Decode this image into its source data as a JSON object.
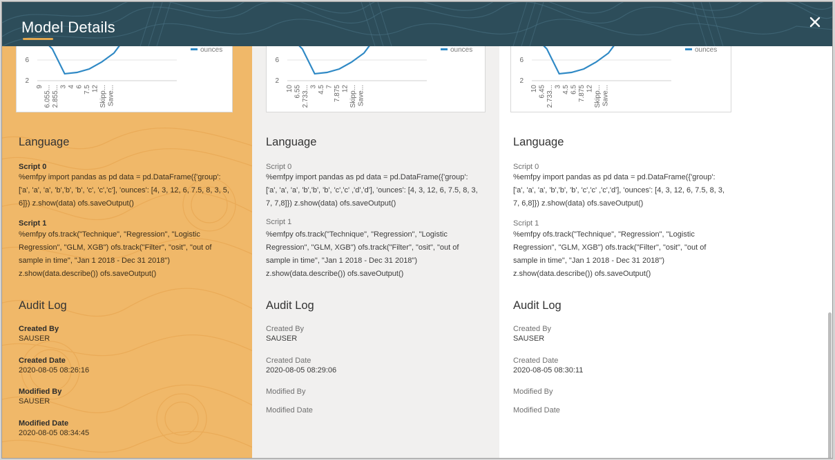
{
  "header": {
    "title": "Model Details",
    "close_icon": "close-icon"
  },
  "colors": {
    "header_bg": "#2d4d5a",
    "accent": "#e3a84f",
    "selected_column_bg": "#f0b869",
    "line": "#2f89c5"
  },
  "columns": [
    {
      "chart": {
        "legend": "ounces",
        "y_ticks": [
          "6",
          "2"
        ],
        "x_ticks": [
          "9",
          "6.055...",
          "2.855...",
          "3",
          "4",
          "6",
          "7.5",
          "12",
          "Skipp...",
          "Save..."
        ]
      },
      "language": {
        "title": "Language",
        "script0_label": "Script 0",
        "script0_lines": [
          "%emfpy import pandas as pd data = pd.DataFrame({'group':",
          "['a', 'a', 'a', 'b','b', 'b', 'c', 'c','c'], 'ounces': [4, 3, 12, 6, 7.5, 8, 3, 5,",
          "6]}) z.show(data) ofs.saveOutput()"
        ],
        "script1_label": "Script 1",
        "script1_lines": [
          "%emfpy ofs.track(\"Technique\", \"Regression\", \"Logistic",
          "Regression\", \"GLM, XGB\") ofs.track(\"Filter\", \"osit\", \"out of",
          "sample in time\", \"Jan 1 2018 - Dec 31 2018\")",
          "z.show(data.describe()) ofs.saveOutput()"
        ]
      },
      "audit": {
        "title": "Audit Log",
        "created_by_label": "Created By",
        "created_by": "SAUSER",
        "created_date_label": "Created Date",
        "created_date": "2020-08-05 08:26:16",
        "modified_by_label": "Modified By",
        "modified_by": "SAUSER",
        "modified_date_label": "Modified Date",
        "modified_date": "2020-08-05 08:34:45"
      }
    },
    {
      "chart": {
        "legend": "ounces",
        "y_ticks": [
          "6",
          "2"
        ],
        "x_ticks": [
          "10",
          "6.55",
          "2.733...",
          "3",
          "4.5",
          "7",
          "7.875",
          "12",
          "Skipp...",
          "Save..."
        ]
      },
      "language": {
        "title": "Language",
        "script0_label": "Script 0",
        "script0_lines": [
          "%emfpy import pandas as pd data = pd.DataFrame({'group':",
          "['a', 'a', 'a', 'b','b', 'b', 'c','c' ,'d','d'], 'ounces': [4, 3, 12, 6, 7.5, 8, 3,",
          "7, 7,8]}) z.show(data) ofs.saveOutput()"
        ],
        "script1_label": "Script 1",
        "script1_lines": [
          "%emfpy ofs.track(\"Technique\", \"Regression\", \"Logistic",
          "Regression\", \"GLM, XGB\") ofs.track(\"Filter\", \"osit\", \"out of",
          "sample in time\", \"Jan 1 2018 - Dec 31 2018\")",
          "z.show(data.describe()) ofs.saveOutput()"
        ]
      },
      "audit": {
        "title": "Audit Log",
        "created_by_label": "Created By",
        "created_by": "SAUSER",
        "created_date_label": "Created Date",
        "created_date": "2020-08-05 08:29:06",
        "modified_by_label": "Modified By",
        "modified_date_label": "Modified Date"
      }
    },
    {
      "chart": {
        "legend": "ounces",
        "y_ticks": [
          "6",
          "2"
        ],
        "x_ticks": [
          "10",
          "6.45",
          "2.733...",
          "3",
          "4.5",
          "6.5",
          "7.875",
          "12",
          "Skipp...",
          "Save..."
        ]
      },
      "language": {
        "title": "Language",
        "script0_label": "Script 0",
        "script0_lines": [
          "%emfpy import pandas as pd data = pd.DataFrame({'group':",
          "['a', 'a', 'a', 'b','b', 'b', 'c','c' ,'c','d'], 'ounces': [4, 3, 12, 6, 7.5, 8, 3,",
          "7, 6,8]}) z.show(data) ofs.saveOutput()"
        ],
        "script1_label": "Script 1",
        "script1_lines": [
          "%emfpy ofs.track(\"Technique\", \"Regression\", \"Logistic",
          "Regression\", \"GLM, XGB\") ofs.track(\"Filter\", \"osit\", \"out of",
          "sample in time\", \"Jan 1 2018 - Dec 31 2018\")",
          "z.show(data.describe()) ofs.saveOutput()"
        ]
      },
      "audit": {
        "title": "Audit Log",
        "created_by_label": "Created By",
        "created_by": "SAUSER",
        "created_date_label": "Created Date",
        "created_date": "2020-08-05 08:30:11",
        "modified_by_label": "Modified By",
        "modified_date_label": "Modified Date"
      }
    }
  ]
}
